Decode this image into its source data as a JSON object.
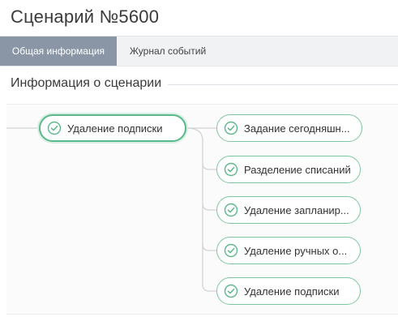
{
  "page": {
    "title": "Сценарий №5600"
  },
  "tabs": [
    {
      "label": "Общая информация",
      "active": true
    },
    {
      "label": "Журнал событий",
      "active": false
    }
  ],
  "section": {
    "title": "Информация о сценарии"
  },
  "flow": {
    "root": {
      "label": "Удаление подписки",
      "icon": "check-circle-icon",
      "status": "completed"
    },
    "children": [
      {
        "label": "Задание сегодняшн...",
        "icon": "check-circle-icon",
        "status": "completed"
      },
      {
        "label": "Разделение списаний",
        "icon": "check-circle-icon",
        "status": "completed"
      },
      {
        "label": "Удаление запланир...",
        "icon": "check-circle-icon",
        "status": "completed"
      },
      {
        "label": "Удаление ручных о...",
        "icon": "check-circle-icon",
        "status": "completed"
      },
      {
        "label": "Удаление подписки",
        "icon": "check-circle-icon",
        "status": "completed"
      }
    ]
  },
  "colors": {
    "node_border": "#7ec6a1",
    "root_border": "#5cb88a",
    "check": "#5cb88a",
    "tab_active_bg": "#8a96a6",
    "connector": "#cfd3d7"
  }
}
